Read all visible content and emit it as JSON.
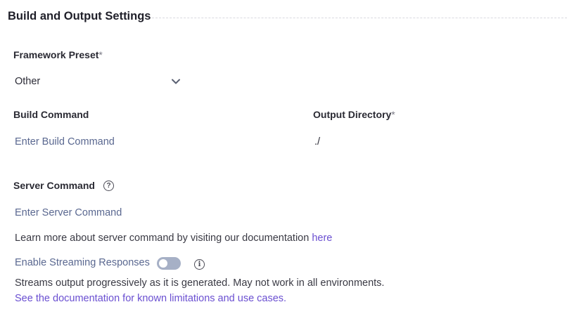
{
  "section": {
    "title": "Build and Output Settings"
  },
  "framework": {
    "label": "Framework Preset",
    "required_mark": "*",
    "selected": "Other"
  },
  "build_command": {
    "label": "Build Command",
    "placeholder": "Enter Build Command",
    "value": ""
  },
  "output_directory": {
    "label": "Output Directory",
    "required_mark": "*",
    "value": "./"
  },
  "server_command": {
    "label": "Server Command",
    "placeholder": "Enter Server Command",
    "value": "",
    "help_text": "Learn more about server command by visiting our documentation ",
    "help_link": "here"
  },
  "streaming": {
    "label": "Enable Streaming Responses",
    "enabled": false,
    "description": "Streams output progressively as it is generated. May not work in all environments.",
    "doc_link": "See the documentation for known limitations and use cases."
  },
  "icons": {
    "dropdown": "chevron-down-icon",
    "help": "question-circle-icon",
    "info": "info-circle-icon"
  },
  "colors": {
    "link": "#6a4fd1",
    "placeholder": "#5a6890",
    "toggle_off": "#a6b0c6"
  }
}
